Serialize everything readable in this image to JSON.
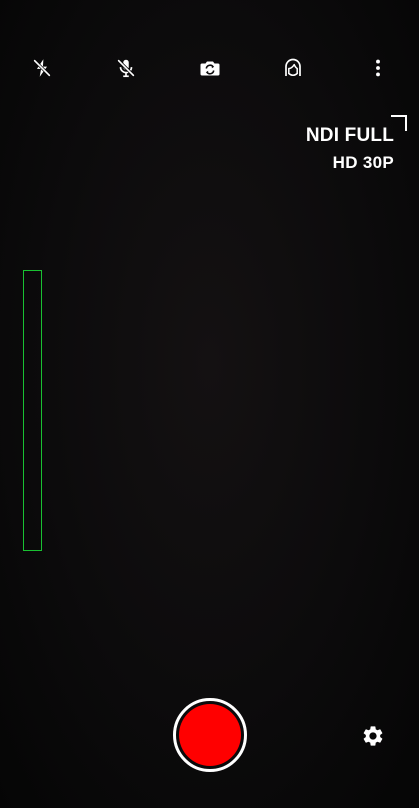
{
  "toolbar": {
    "icons": [
      "flash-off-icon",
      "mic-off-icon",
      "camera-flip-icon",
      "face-icon",
      "more-vert-icon"
    ]
  },
  "stream_format": {
    "line1": "NDI FULL",
    "line2": "HD 30P"
  },
  "colors": {
    "background": "#0c0b0c",
    "record": "#ff0000",
    "level_meter": "#19c132",
    "icon": "#ffffff"
  }
}
